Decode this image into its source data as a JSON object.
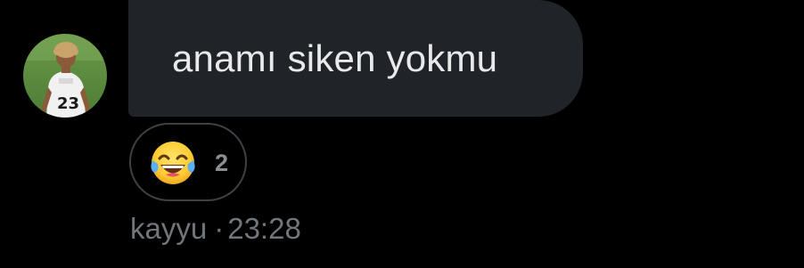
{
  "message": {
    "text": "anamı siken yokmu",
    "reaction": {
      "icon": "face-with-tears-of-joy-icon",
      "count": "2"
    },
    "sender": "kayyu",
    "separator": "·",
    "time": "23:28"
  },
  "colors": {
    "background": "#000000",
    "bubble": "#202327",
    "message_text": "#e7e9ea",
    "meta_text": "#71767b",
    "reaction_border": "#3e4144"
  }
}
